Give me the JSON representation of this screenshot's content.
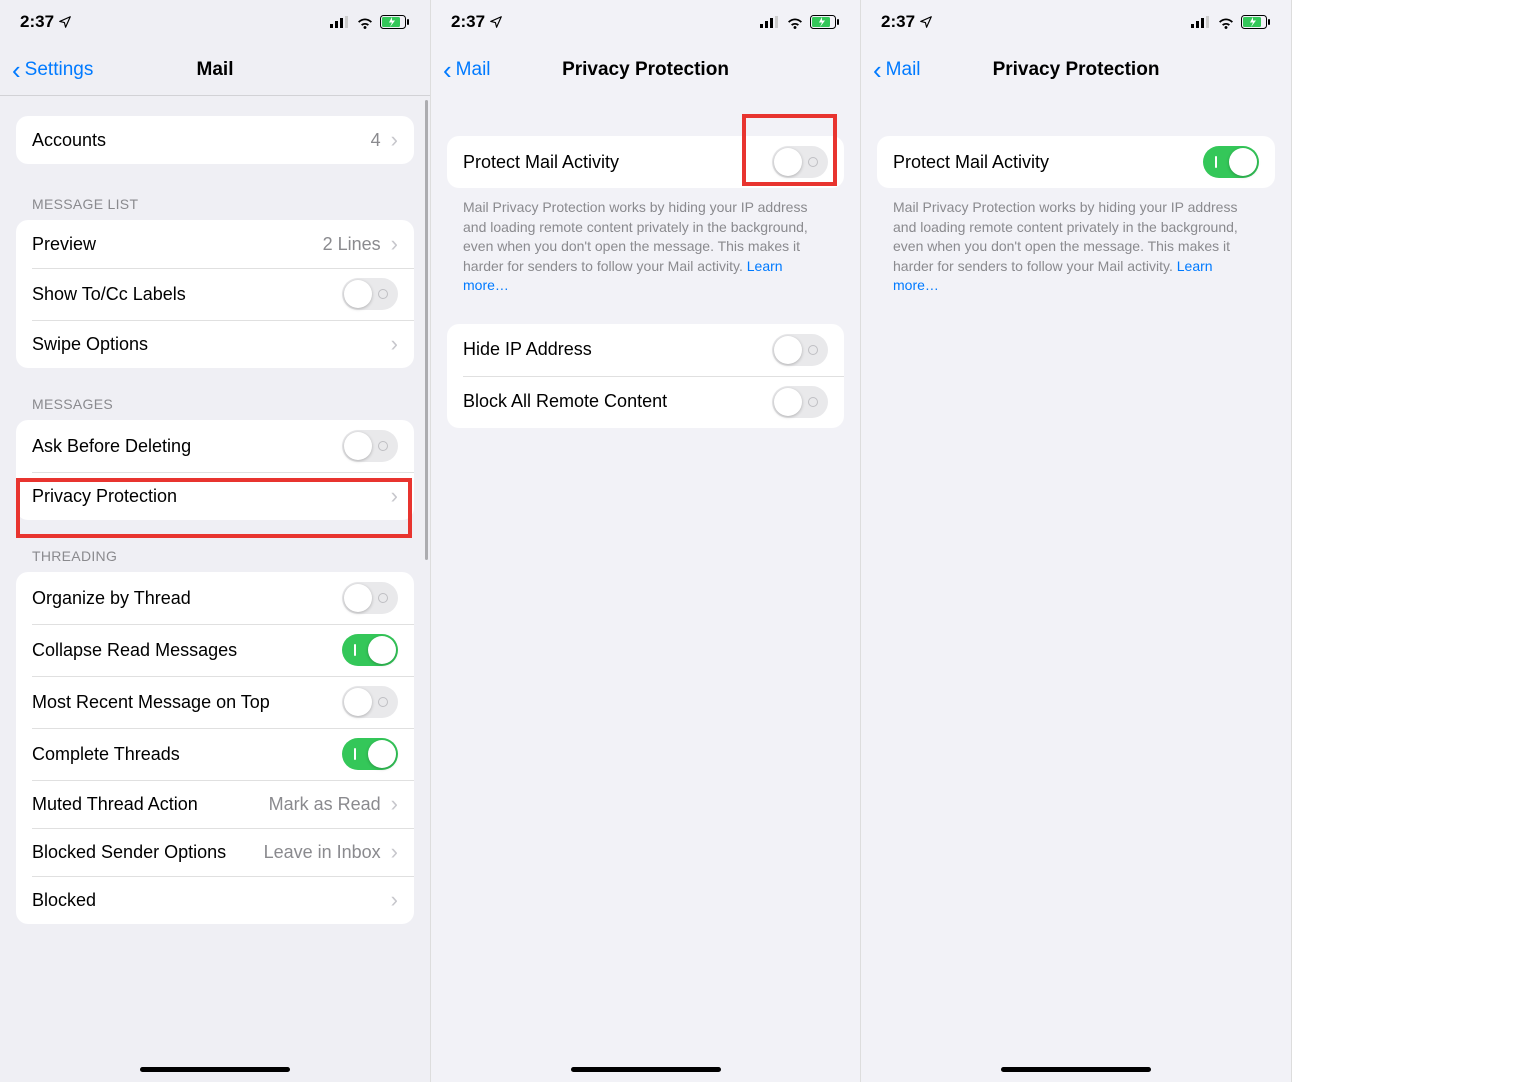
{
  "status": {
    "time": "2:37"
  },
  "screen1": {
    "back": "Settings",
    "title": "Mail",
    "accounts": {
      "label": "Accounts",
      "value": "4"
    },
    "header_message_list": "MESSAGE LIST",
    "preview": {
      "label": "Preview",
      "value": "2 Lines"
    },
    "show_tocc": {
      "label": "Show To/Cc Labels"
    },
    "swipe_options": {
      "label": "Swipe Options"
    },
    "header_messages": "MESSAGES",
    "ask_before_deleting": {
      "label": "Ask Before Deleting"
    },
    "privacy_protection": {
      "label": "Privacy Protection"
    },
    "header_threading": "THREADING",
    "organize_by_thread": {
      "label": "Organize by Thread"
    },
    "collapse_read": {
      "label": "Collapse Read Messages"
    },
    "most_recent_top": {
      "label": "Most Recent Message on Top"
    },
    "complete_threads": {
      "label": "Complete Threads"
    },
    "muted_action": {
      "label": "Muted Thread Action",
      "value": "Mark as Read"
    },
    "blocked_sender": {
      "label": "Blocked Sender Options",
      "value": "Leave in Inbox"
    },
    "blocked": {
      "label": "Blocked"
    }
  },
  "screen2": {
    "back": "Mail",
    "title": "Privacy Protection",
    "protect_mail": {
      "label": "Protect Mail Activity"
    },
    "footer": "Mail Privacy Protection works by hiding your IP address and loading remote content privately in the background, even when you don't open the message. This makes it harder for senders to follow your Mail activity. ",
    "learn_more": "Learn more…",
    "hide_ip": {
      "label": "Hide IP Address"
    },
    "block_remote": {
      "label": "Block All Remote Content"
    }
  },
  "screen3": {
    "back": "Mail",
    "title": "Privacy Protection",
    "protect_mail": {
      "label": "Protect Mail Activity"
    },
    "footer": "Mail Privacy Protection works by hiding your IP address and loading remote content privately in the background, even when you don't open the message. This makes it harder for senders to follow your Mail activity. ",
    "learn_more": "Learn more…"
  }
}
